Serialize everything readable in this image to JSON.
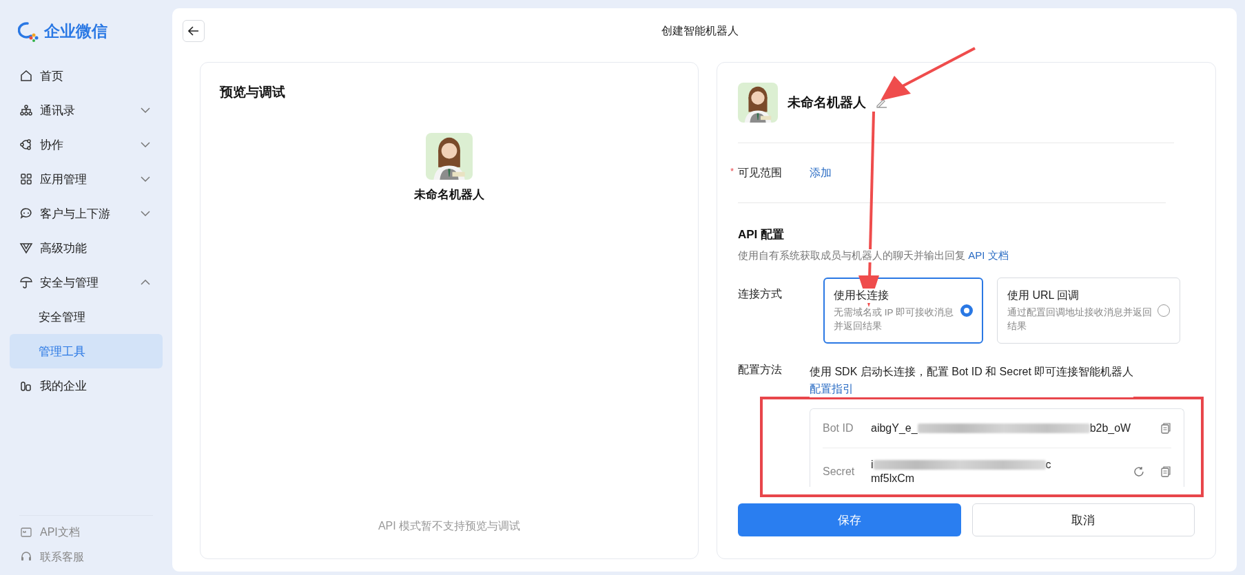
{
  "sidebar": {
    "logo": "企业微信",
    "items": [
      {
        "label": "首页",
        "selected": false
      },
      {
        "label": "通讯录",
        "selected": false,
        "expanded": false
      },
      {
        "label": "协作",
        "selected": false,
        "expanded": false
      },
      {
        "label": "应用管理",
        "selected": false,
        "expanded": false
      },
      {
        "label": "客户与上下游",
        "selected": false,
        "expanded": false
      },
      {
        "label": "高级功能",
        "selected": false
      },
      {
        "label": "安全与管理",
        "selected": false,
        "expanded": true,
        "children": [
          {
            "label": "安全管理",
            "selected": false
          },
          {
            "label": "管理工具",
            "selected": true
          }
        ]
      },
      {
        "label": "我的企业",
        "selected": false
      }
    ],
    "footer": [
      {
        "label": "API文档"
      },
      {
        "label": "联系客服"
      }
    ]
  },
  "page": {
    "title": "创建智能机器人"
  },
  "preview": {
    "title": "预览与调试",
    "bot_name": "未命名机器人",
    "note": "API 模式暂不支持预览与调试"
  },
  "config": {
    "bot_name": "未命名机器人",
    "visibility": {
      "label": "可见范围",
      "required_mark": "*",
      "action": "添加"
    },
    "api": {
      "heading": "API 配置",
      "description": "使用自有系统获取成员与机器人的聊天并输出回复",
      "doc_link": "API 文档"
    },
    "connection": {
      "label": "连接方式",
      "options": [
        {
          "title": "使用长连接",
          "description": "无需域名或 IP 即可接收消息并返回结果",
          "selected": true
        },
        {
          "title": "使用 URL 回调",
          "description": "通过配置回调地址接收消息并返回结果",
          "selected": false
        }
      ]
    },
    "method": {
      "label": "配置方法",
      "text": "使用 SDK 启动长连接，配置 Bot ID 和 Secret 即可连接智能机器人",
      "link": "配置指引"
    },
    "credentials": [
      {
        "label": "Bot ID",
        "value_start": "aibgY_e_",
        "value_end": "b2b_oW",
        "refresh": false
      },
      {
        "label": "Secret",
        "value_start": "i",
        "value_end": "c",
        "value_line2": "mf5lxCm",
        "refresh": true
      }
    ],
    "buttons": [
      {
        "label": "保存",
        "kind": "primary"
      },
      {
        "label": "取消",
        "kind": "secondary"
      }
    ]
  }
}
